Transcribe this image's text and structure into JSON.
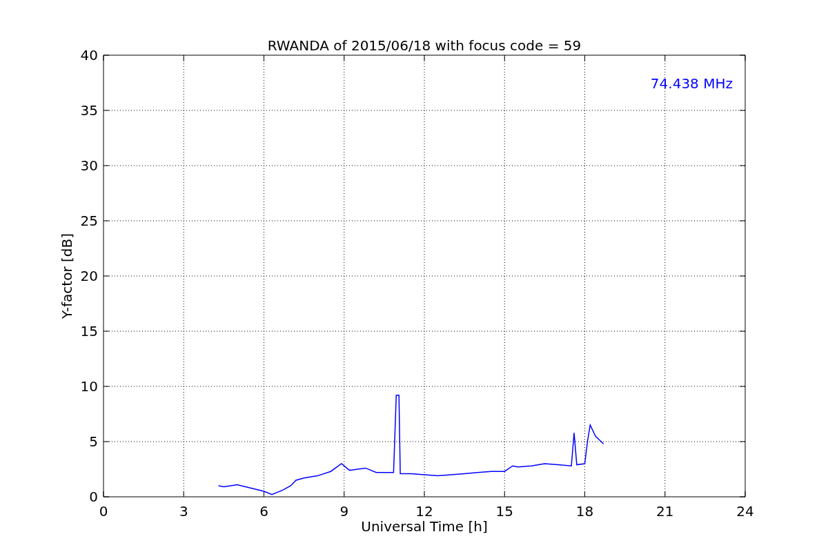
{
  "chart_data": {
    "type": "line",
    "title": "RWANDA of 2015/06/18 with focus code = 59",
    "xlabel": "Universal Time [h]",
    "ylabel": "Y-factor [dB]",
    "x": [
      4.3,
      4.5,
      5.0,
      5.5,
      6.0,
      6.3,
      6.7,
      7.0,
      7.2,
      7.5,
      8.0,
      8.5,
      8.9,
      9.2,
      9.5,
      9.8,
      10.2,
      10.85,
      10.95,
      11.05,
      11.1,
      11.5,
      12.0,
      12.5,
      13.0,
      13.5,
      14.0,
      14.5,
      15.0,
      15.3,
      15.5,
      16.0,
      16.5,
      17.0,
      17.5,
      17.6,
      17.7,
      18.0,
      18.1,
      18.2,
      18.4,
      18.7
    ],
    "series": [
      {
        "name": "74.438 MHz",
        "color": "#0000ff",
        "values": [
          1.0,
          0.9,
          1.1,
          0.8,
          0.5,
          0.2,
          0.6,
          1.0,
          1.5,
          1.7,
          1.9,
          2.3,
          3.0,
          2.4,
          2.5,
          2.6,
          2.2,
          2.2,
          9.2,
          9.2,
          2.1,
          2.1,
          2.0,
          1.9,
          2.0,
          2.1,
          2.2,
          2.3,
          2.3,
          2.8,
          2.7,
          2.8,
          3.0,
          2.9,
          2.8,
          5.8,
          2.9,
          3.0,
          5.0,
          6.5,
          5.5,
          4.8
        ]
      }
    ],
    "xlim": [
      0,
      24
    ],
    "ylim": [
      0,
      40
    ],
    "xticks": [
      0,
      3,
      6,
      9,
      12,
      15,
      18,
      21,
      24
    ],
    "yticks": [
      0,
      5,
      10,
      15,
      20,
      25,
      30,
      35,
      40
    ],
    "grid": true
  }
}
